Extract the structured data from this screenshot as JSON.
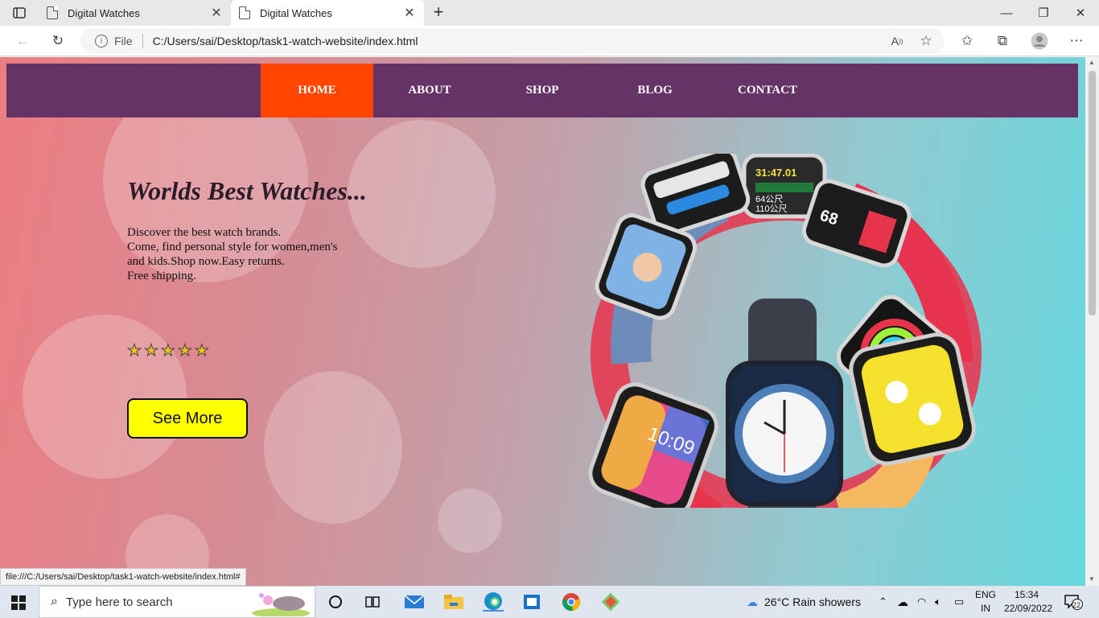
{
  "browser": {
    "tabs": [
      {
        "title": "Digital Watches",
        "active": false
      },
      {
        "title": "Digital Watches",
        "active": true
      }
    ],
    "address": {
      "scheme_label": "File",
      "url": "C:/Users/sai/Desktop/task1-watch-website/index.html"
    },
    "status_url": "file:///C:/Users/sai/Desktop/task1-watch-website/index.html#"
  },
  "page": {
    "nav": [
      "HOME",
      "ABOUT",
      "SHOP",
      "BLOG",
      "CONTACT"
    ],
    "active_nav": "HOME",
    "hero": {
      "title": "Worlds Best Watches...",
      "lines": [
        "Discover the best watch brands.",
        "Come, find personal style for women,men's",
        "and kids.Shop now.Easy returns.",
        "Free shipping."
      ],
      "rating": 5,
      "button": "See More"
    },
    "watch_faces": [
      "31:47.01",
      "64公尺",
      "110公尺",
      "68",
      "10:09"
    ],
    "colors": {
      "nav": "#663366",
      "active_nav": "#ff4500",
      "button": "#ffff00"
    }
  },
  "taskbar": {
    "search_placeholder": "Type here to search",
    "weather": "26°C  Rain showers",
    "lang_line1": "ENG",
    "lang_line2": "IN",
    "time": "15:34",
    "date": "22/09/2022",
    "notifications": "22"
  }
}
